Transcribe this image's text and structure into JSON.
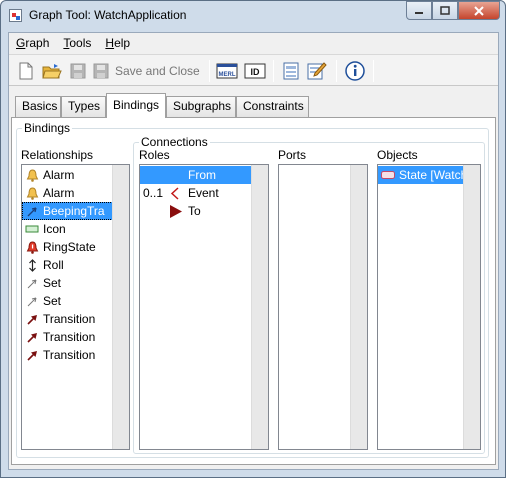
{
  "window": {
    "title": "Graph Tool: WatchApplication"
  },
  "menu": [
    {
      "label": "Graph",
      "key": "G",
      "rest": "raph"
    },
    {
      "label": "Tools",
      "key": "T",
      "rest": "ools"
    },
    {
      "label": "Help",
      "key": "H",
      "rest": "elp"
    }
  ],
  "toolbar": {
    "save_and_close": "Save and Close",
    "merl_icon_text": "MERL",
    "id_icon_text": "ID"
  },
  "tabs": [
    "Basics",
    "Types",
    "Bindings",
    "Subgraphs",
    "Constraints"
  ],
  "active_tab": "Bindings",
  "bindings": {
    "group_label": "Bindings",
    "relationships_label": "Relationships",
    "relationships": [
      {
        "label": "Alarm",
        "icon": "bell-icon"
      },
      {
        "label": "Alarm",
        "icon": "bell-icon"
      },
      {
        "label": "BeepingTra",
        "icon": "arrow-icon",
        "selected": true
      },
      {
        "label": "Icon",
        "icon": "rectangle-icon"
      },
      {
        "label": "RingState",
        "icon": "alarm-bell-icon"
      },
      {
        "label": "Roll",
        "icon": "double-arrow-icon"
      },
      {
        "label": "Set",
        "icon": "thin-arrow-icon"
      },
      {
        "label": "Set",
        "icon": "thin-arrow-icon"
      },
      {
        "label": "Transition",
        "icon": "dark-arrow-icon"
      },
      {
        "label": "Transition",
        "icon": "dark-arrow-icon"
      },
      {
        "label": "Transition",
        "icon": "dark-arrow-icon"
      }
    ],
    "connections_label": "Connections",
    "roles_label": "Roles",
    "roles": [
      {
        "card": "",
        "label": "From",
        "icon": "",
        "selected": true
      },
      {
        "card": "0..1",
        "label": "Event",
        "icon": "chevron-left-icon"
      },
      {
        "card": "",
        "label": "To",
        "icon": "triangle-right-icon"
      }
    ],
    "ports_label": "Ports",
    "objects_label": "Objects",
    "objects": [
      {
        "label": "State [Watch",
        "icon": "state-icon"
      }
    ]
  }
}
